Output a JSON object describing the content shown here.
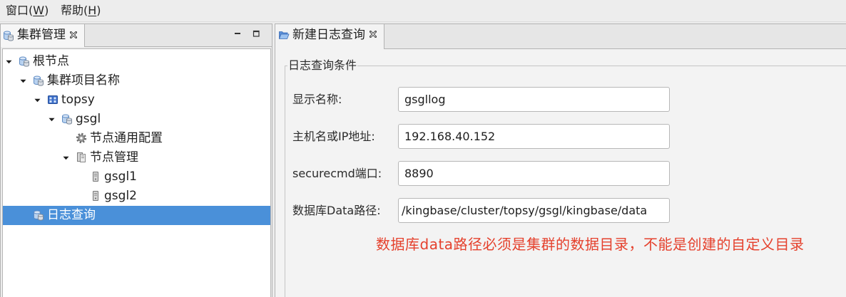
{
  "menu": {
    "items": [
      {
        "label": "窗口(W)",
        "mnemonic": "W"
      },
      {
        "label": "帮助(H)",
        "mnemonic": "H"
      }
    ]
  },
  "left_panel": {
    "tab": {
      "label": "集群管理",
      "icon": "cluster-db-icon",
      "close_icon": "close-icon"
    },
    "controls": {
      "minimize_icon": "minimize-icon",
      "maximize_icon": "maximize-icon"
    },
    "tree": {
      "label": "根节点",
      "icon": "cluster-db-icon",
      "expanded": true,
      "children": [
        {
          "label": "集群项目名称",
          "icon": "cluster-db-icon",
          "expanded": true,
          "children": [
            {
              "label": "topsy",
              "icon": "cluster-grid-icon",
              "expanded": true,
              "children": [
                {
                  "label": "gsgl",
                  "icon": "cluster-db-icon",
                  "expanded": true,
                  "children": [
                    {
                      "label": "节点通用配置",
                      "icon": "gear-icon"
                    },
                    {
                      "label": "节点管理",
                      "icon": "server-stack-icon",
                      "expanded": true,
                      "children": [
                        {
                          "label": "gsgl1",
                          "icon": "server-node-icon"
                        },
                        {
                          "label": "gsgl2",
                          "icon": "server-node-icon"
                        }
                      ]
                    }
                  ]
                }
              ]
            }
          ]
        },
        {
          "label": "日志查询",
          "icon": "cluster-db-icon",
          "selected": true
        }
      ]
    }
  },
  "right_panel": {
    "tab": {
      "label": "新建日志查询",
      "icon": "folder-open-icon",
      "close_icon": "close-icon"
    },
    "group_title": "日志查询条件",
    "fields": [
      {
        "label": "显示名称:",
        "value": "gsgllog"
      },
      {
        "label": "主机名或IP地址:",
        "value": "192.168.40.152"
      },
      {
        "label": "securecmd端口:",
        "value": "8890"
      },
      {
        "label": "数据库Data路径:",
        "value": "/kingbase/cluster/topsy/gsgl/kingbase/data"
      }
    ],
    "note": "数据库data路径必须是集群的数据目录，不能是创建的自定义目录"
  },
  "colors": {
    "selection": "#4a90d9",
    "selection_text": "#ffffff",
    "note": "#e5412d"
  }
}
